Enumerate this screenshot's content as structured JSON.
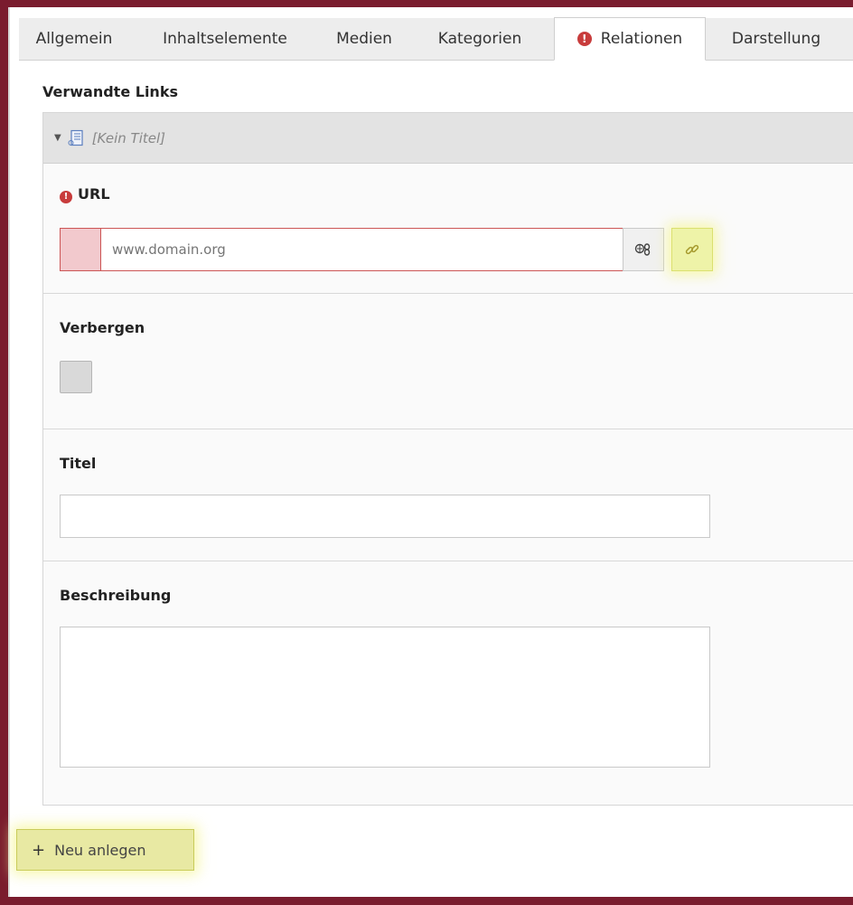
{
  "tabs": [
    {
      "label": "Allgemein"
    },
    {
      "label": "Inhaltselemente"
    },
    {
      "label": "Medien"
    },
    {
      "label": "Kategorien"
    },
    {
      "label": "Relationen",
      "active": true,
      "has_error": true
    },
    {
      "label": "Darstellung"
    }
  ],
  "section": {
    "title": "Verwandte Links"
  },
  "record": {
    "title": "[Kein Titel]"
  },
  "fields": {
    "url": {
      "label": "URL",
      "placeholder": "www.domain.org",
      "value": "",
      "required_error": true
    },
    "hidden": {
      "label": "Verbergen",
      "checked": false
    },
    "title": {
      "label": "Titel",
      "value": ""
    },
    "description": {
      "label": "Beschreibung",
      "value": ""
    }
  },
  "actions": {
    "new_label": "Neu anlegen"
  },
  "colors": {
    "accent_error": "#c83c3c",
    "highlight": "#eef3a8",
    "frame": "#7a1c2e"
  }
}
